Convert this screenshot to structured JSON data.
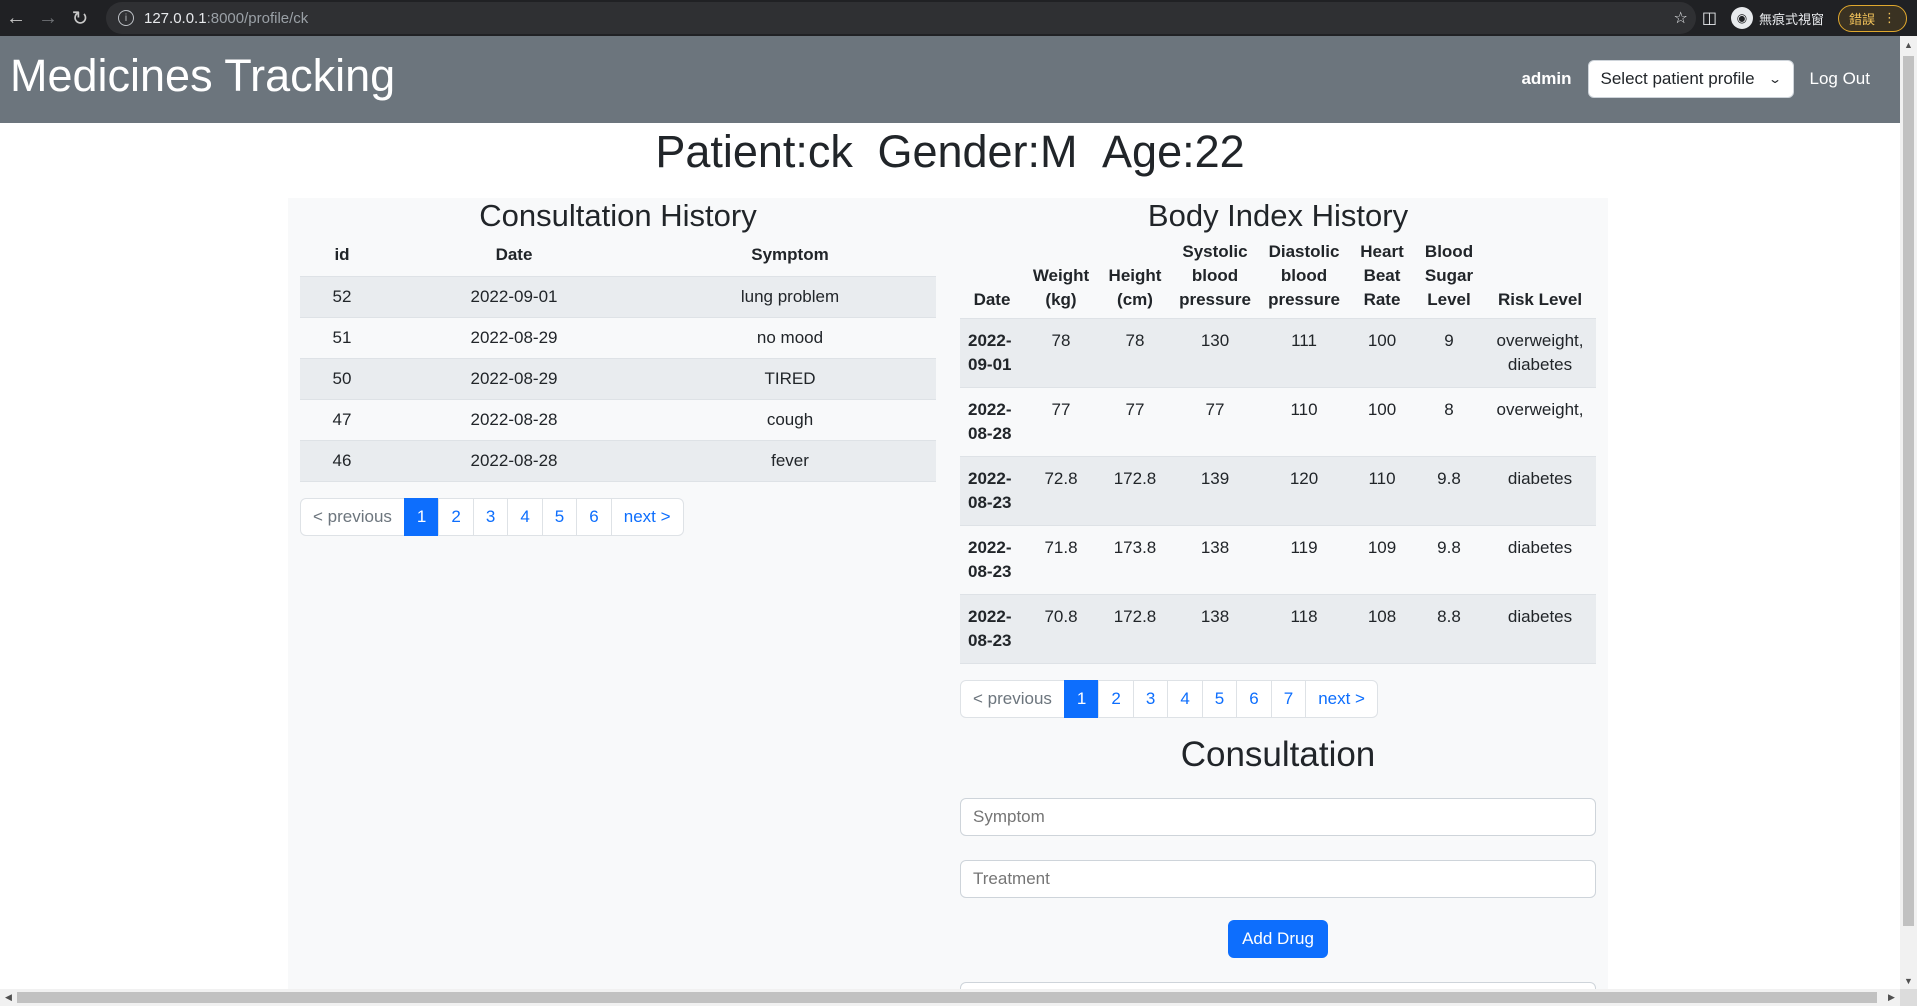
{
  "browser": {
    "url_host": "127.0.0.1",
    "url_path": ":8000/profile/ck",
    "incognito_label": "無痕式視窗",
    "error_button_label": "錯誤"
  },
  "navbar": {
    "brand": "Medicines Tracking",
    "user": "admin",
    "profile_select": "Select patient profile",
    "logout": "Log Out"
  },
  "patient": {
    "name": "Patient:ck",
    "gender": "Gender:M",
    "age": "Age:22"
  },
  "consultation_history": {
    "title": "Consultation History",
    "headers": [
      "id",
      "Date",
      "Symptom"
    ],
    "rows": [
      {
        "id": "52",
        "date": "2022-09-01",
        "symptom": "lung problem"
      },
      {
        "id": "51",
        "date": "2022-08-29",
        "symptom": "no mood"
      },
      {
        "id": "50",
        "date": "2022-08-29",
        "symptom": "TIRED"
      },
      {
        "id": "47",
        "date": "2022-08-28",
        "symptom": "cough"
      },
      {
        "id": "46",
        "date": "2022-08-28",
        "symptom": "fever"
      }
    ],
    "pagination": {
      "previous": "< previous",
      "pages": [
        "1",
        "2",
        "3",
        "4",
        "5",
        "6"
      ],
      "next": "next >",
      "active": "1"
    }
  },
  "body_index_history": {
    "title": "Body Index History",
    "headers": {
      "date": "Date",
      "weight": [
        "Weight",
        "(kg)"
      ],
      "height": [
        "Height",
        "(cm)"
      ],
      "systolic": [
        "Systolic",
        "blood",
        "pressure"
      ],
      "diastolic": [
        "Diastolic",
        "blood",
        "pressure"
      ],
      "heart": [
        "Heart",
        "Beat",
        "Rate"
      ],
      "sugar": [
        "Blood",
        "Sugar",
        "Level"
      ],
      "risk": "Risk Level"
    },
    "rows": [
      {
        "date": [
          "2022-",
          "09-01"
        ],
        "weight": "78",
        "height": "78",
        "systolic": "130",
        "diastolic": "111",
        "heart": "100",
        "sugar": "9",
        "risk": [
          "overweight,",
          "diabetes"
        ]
      },
      {
        "date": [
          "2022-",
          "08-28"
        ],
        "weight": "77",
        "height": "77",
        "systolic": "77",
        "diastolic": "110",
        "heart": "100",
        "sugar": "8",
        "risk": [
          "overweight,",
          ""
        ]
      },
      {
        "date": [
          "2022-",
          "08-23"
        ],
        "weight": "72.8",
        "height": "172.8",
        "systolic": "139",
        "diastolic": "120",
        "heart": "110",
        "sugar": "9.8",
        "risk": [
          "diabetes",
          ""
        ]
      },
      {
        "date": [
          "2022-",
          "08-23"
        ],
        "weight": "71.8",
        "height": "173.8",
        "systolic": "138",
        "diastolic": "119",
        "heart": "109",
        "sugar": "9.8",
        "risk": [
          "diabetes",
          ""
        ]
      },
      {
        "date": [
          "2022-",
          "08-23"
        ],
        "weight": "70.8",
        "height": "172.8",
        "systolic": "138",
        "diastolic": "118",
        "heart": "108",
        "sugar": "8.8",
        "risk": [
          "diabetes",
          ""
        ]
      }
    ],
    "pagination": {
      "previous": "< previous",
      "pages": [
        "1",
        "2",
        "3",
        "4",
        "5",
        "6",
        "7"
      ],
      "next": "next >",
      "active": "1"
    }
  },
  "consultation_form": {
    "title": "Consultation",
    "symptom_placeholder": "Symptom",
    "treatment_placeholder": "Treatment",
    "add_drug_label": "Add Drug"
  },
  "colors": {
    "navbar": "#6c757d",
    "primary": "#0d6efd",
    "stripe": "#e9ecef",
    "container": "#f8f9fa"
  }
}
